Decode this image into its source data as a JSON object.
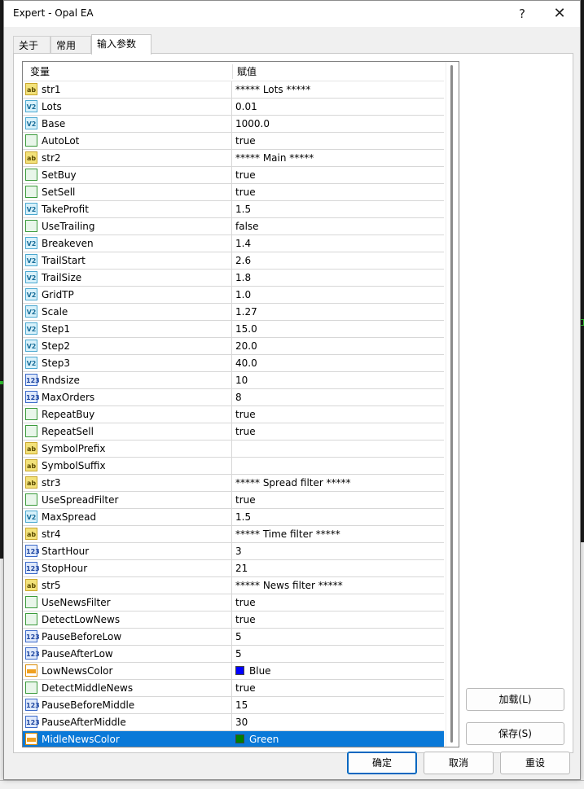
{
  "window": {
    "title": "Expert - Opal EA",
    "help_glyph": "?",
    "close_glyph": "✕"
  },
  "tabs": [
    {
      "label": "关于"
    },
    {
      "label": "常用"
    },
    {
      "label": "输入参数"
    }
  ],
  "active_tab": 2,
  "grid": {
    "headers": {
      "variable": "变量",
      "value": "赋值"
    },
    "icons": {
      "string": "ab",
      "double": "V2",
      "bool": "",
      "int": "123",
      "color": ""
    },
    "rows": [
      {
        "name": "str1",
        "value": "***** Lots *****",
        "type": "string"
      },
      {
        "name": "Lots",
        "value": "0.01",
        "type": "double"
      },
      {
        "name": "Base",
        "value": "1000.0",
        "type": "double"
      },
      {
        "name": "AutoLot",
        "value": "true",
        "type": "bool"
      },
      {
        "name": "str2",
        "value": "***** Main *****",
        "type": "string"
      },
      {
        "name": "SetBuy",
        "value": "true",
        "type": "bool"
      },
      {
        "name": "SetSell",
        "value": "true",
        "type": "bool"
      },
      {
        "name": "TakeProfit",
        "value": "1.5",
        "type": "double"
      },
      {
        "name": "UseTrailing",
        "value": "false",
        "type": "bool"
      },
      {
        "name": "Breakeven",
        "value": "1.4",
        "type": "double"
      },
      {
        "name": "TrailStart",
        "value": "2.6",
        "type": "double"
      },
      {
        "name": "TrailSize",
        "value": "1.8",
        "type": "double"
      },
      {
        "name": "GridTP",
        "value": "1.0",
        "type": "double"
      },
      {
        "name": "Scale",
        "value": "1.27",
        "type": "double"
      },
      {
        "name": "Step1",
        "value": "15.0",
        "type": "double"
      },
      {
        "name": "Step2",
        "value": "20.0",
        "type": "double"
      },
      {
        "name": "Step3",
        "value": "40.0",
        "type": "double"
      },
      {
        "name": "Rndsize",
        "value": "10",
        "type": "int"
      },
      {
        "name": "MaxOrders",
        "value": "8",
        "type": "int"
      },
      {
        "name": "RepeatBuy",
        "value": "true",
        "type": "bool"
      },
      {
        "name": "RepeatSell",
        "value": "true",
        "type": "bool"
      },
      {
        "name": "SymbolPrefix",
        "value": "",
        "type": "string"
      },
      {
        "name": "SymbolSuffix",
        "value": "",
        "type": "string"
      },
      {
        "name": "str3",
        "value": "***** Spread filter *****",
        "type": "string"
      },
      {
        "name": "UseSpreadFilter",
        "value": "true",
        "type": "bool"
      },
      {
        "name": "MaxSpread",
        "value": "1.5",
        "type": "double"
      },
      {
        "name": "str4",
        "value": "***** Time filter *****",
        "type": "string"
      },
      {
        "name": "StartHour",
        "value": "3",
        "type": "int"
      },
      {
        "name": "StopHour",
        "value": "21",
        "type": "int"
      },
      {
        "name": "str5",
        "value": "***** News filter *****",
        "type": "string"
      },
      {
        "name": "UseNewsFilter",
        "value": "true",
        "type": "bool"
      },
      {
        "name": "DetectLowNews",
        "value": "true",
        "type": "bool"
      },
      {
        "name": "PauseBeforeLow",
        "value": "5",
        "type": "int"
      },
      {
        "name": "PauseAfterLow",
        "value": "5",
        "type": "int"
      },
      {
        "name": "LowNewsColor",
        "value": "Blue",
        "type": "color",
        "swatch": "#0000ff"
      },
      {
        "name": "DetectMiddleNews",
        "value": "true",
        "type": "bool"
      },
      {
        "name": "PauseBeforeMiddle",
        "value": "15",
        "type": "int"
      },
      {
        "name": "PauseAfterMiddle",
        "value": "30",
        "type": "int"
      },
      {
        "name": "MidleNewsColor",
        "value": "Green",
        "type": "color",
        "swatch": "#008000",
        "selected": true
      }
    ]
  },
  "buttons": {
    "load": "加载(L)",
    "save": "保存(S)",
    "ok": "确定",
    "cancel": "取消",
    "reset": "重设"
  },
  "colors": {
    "selection": "#0a79d8",
    "accent": "#0067c0"
  }
}
